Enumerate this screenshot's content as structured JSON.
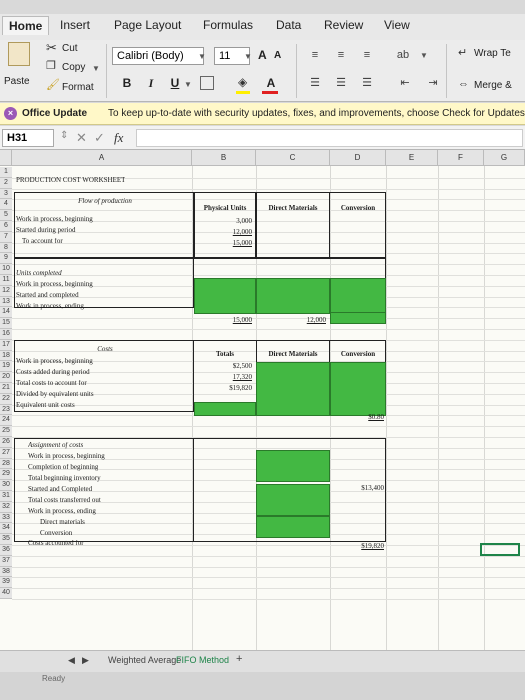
{
  "ribbon_tabs": [
    "Home",
    "Insert",
    "Page Layout",
    "Formulas",
    "Data",
    "Review",
    "View"
  ],
  "clipboard": {
    "paste": "Paste",
    "cut": "Cut",
    "copy": "Copy",
    "format": "Format"
  },
  "font": {
    "name": "Calibri (Body)",
    "size": "11",
    "grow": "A",
    "shrink": "A",
    "bold": "B",
    "italic": "I",
    "underline": "U",
    "fill_a": "A"
  },
  "alignment": {
    "wrap_text": "Wrap Te",
    "merge": "Merge &"
  },
  "message_bar": {
    "title": "Office Update",
    "text": "To keep up-to-date with security updates, fixes, and improvements, choose Check for Updates."
  },
  "formula_bar": {
    "name_box": "H31",
    "fx": "fx"
  },
  "columns": [
    "A",
    "B",
    "C",
    "D",
    "E",
    "F",
    "G"
  ],
  "rows": [
    "1",
    "2",
    "3",
    "4",
    "5",
    "6",
    "7",
    "8",
    "9",
    "10",
    "11",
    "12",
    "13",
    "14",
    "15",
    "16",
    "17",
    "18",
    "19",
    "20",
    "21",
    "22",
    "23",
    "24",
    "25",
    "26",
    "27",
    "28",
    "29",
    "30",
    "31",
    "32",
    "33",
    "34",
    "35",
    "36",
    "37",
    "38",
    "39",
    "40"
  ],
  "worksheet": {
    "title": "PRODUCTION COST WORKSHEET",
    "flow_header": "Flow of production",
    "physical_units": "Physical Units",
    "direct_materials": "Direct Materials",
    "conversion": "Conversion",
    "wip_beginning": "Work in process, beginning",
    "started": "Started during period",
    "to_account": "To account for",
    "phys_1": "3,000",
    "phys_2": "12,000",
    "phys_3": "15,000",
    "units_completed": "Units completed",
    "u_wip_beg": "Work in process, beginning",
    "u_started_completed": "Started and completed",
    "u_wip_end": "Work in process, ending",
    "units_total_1": "15,000",
    "units_total_2": "12,000",
    "costs": "Costs",
    "totals": "Totals",
    "direct_materials_2": "Direct Materials",
    "conversion_2": "Conversion",
    "c_wip_beg": "Work in process, beginning",
    "c_added": "Costs added during period",
    "c_total": "Total costs to account for",
    "c_divided": "Divided by equivalent units",
    "c_equiv": "Equivalent unit costs",
    "cost_1": "$2,500",
    "cost_2": "17,320",
    "cost_3": "$19,820",
    "equiv_cost": "$0.80",
    "assignment": "Assignment of costs",
    "a_wip_beg": "Work in process, beginning",
    "a_completion": "Completion of beginning",
    "a_total_beg": "Total beginning inventory",
    "a_started": "Started and Completed",
    "a_transferred": "Total costs transferred out",
    "a_wip_end": "Work in process, ending",
    "a_direct": "Direct materials",
    "a_conversion": "Conversion",
    "a_accounted": "Costs accounted for",
    "transferred_val": "$13,400",
    "accounted_val": "$19,820"
  },
  "sheet_tabs": [
    "Weighted Average",
    "FIFO Method"
  ],
  "add_sheet": "+",
  "status": "Ready",
  "colors": {
    "fill_green": "#43b843",
    "accent": "#1e8449",
    "font_color_bar": "#e02020"
  }
}
